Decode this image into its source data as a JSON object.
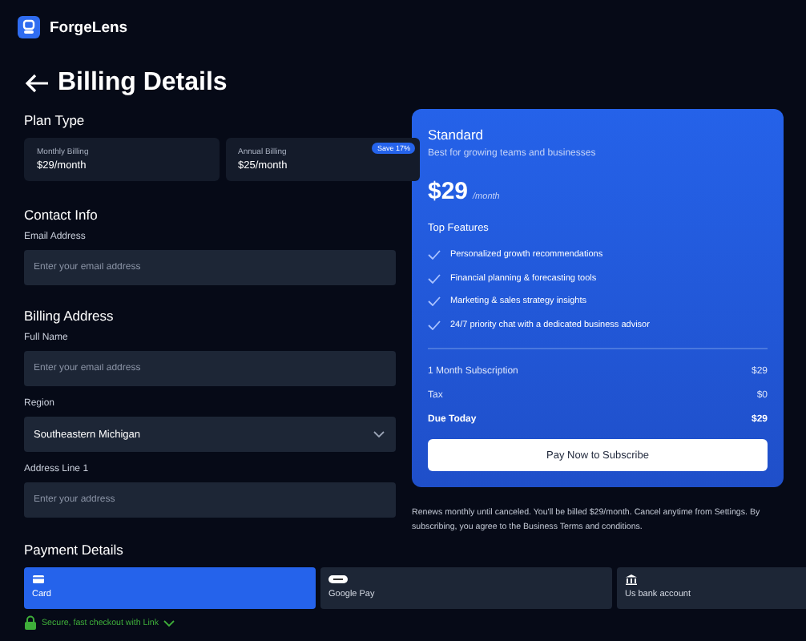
{
  "app": {
    "name": "ForgeLens"
  },
  "page": {
    "title": "Billing Details"
  },
  "plan_type": {
    "heading": "Plan Type",
    "options": [
      {
        "label": "Monthly Billing",
        "price": "$29/month"
      },
      {
        "label": "Annual Billing",
        "price": "$25/month",
        "badge": "Save 17%"
      }
    ]
  },
  "contact": {
    "heading": "Contact Info",
    "fields": [
      {
        "label": "Email Address",
        "placeholder": "Enter your email address",
        "kind": "text"
      }
    ]
  },
  "billing_address": {
    "heading": "Billing Address",
    "fields": [
      {
        "label": "Full Name",
        "placeholder": "Enter your email address",
        "kind": "text"
      },
      {
        "label": "Region",
        "value": "Southeastern Michigan",
        "kind": "select"
      },
      {
        "label": "Address Line 1",
        "placeholder": "Enter your address",
        "kind": "text"
      }
    ]
  },
  "payment": {
    "heading": "Payment Details",
    "methods": [
      {
        "label": "Card",
        "kind": "card",
        "selected": true
      },
      {
        "label": "Google Pay",
        "kind": "gpay",
        "selected": false
      },
      {
        "label": "Us bank account",
        "kind": "bank",
        "selected": false
      }
    ],
    "secure_link": "Secure, fast checkout with Link"
  },
  "summary": {
    "plan": "Standard",
    "tagline": "Best for growing teams and businesses",
    "price": "$29",
    "period": "/month",
    "features_heading": "Top Features",
    "features": [
      "Personalized growth recommendations",
      "Financial planning & forecasting tools",
      "Marketing & sales strategy insights",
      "24/7 priority chat with a dedicated business advisor"
    ],
    "lines": [
      {
        "label": "1 Month Subscription",
        "amount": "$29",
        "emphasis": false
      },
      {
        "label": "Tax",
        "amount": "$0",
        "emphasis": false
      },
      {
        "label": "Due Today",
        "amount": "$29",
        "emphasis": true
      }
    ],
    "button": "Pay Now to Subscribe",
    "note": "Renews monthly until canceled. You'll be billed $29/month. Cancel anytime from Settings. By subscribing, you agree to the Business Terms and conditions."
  }
}
